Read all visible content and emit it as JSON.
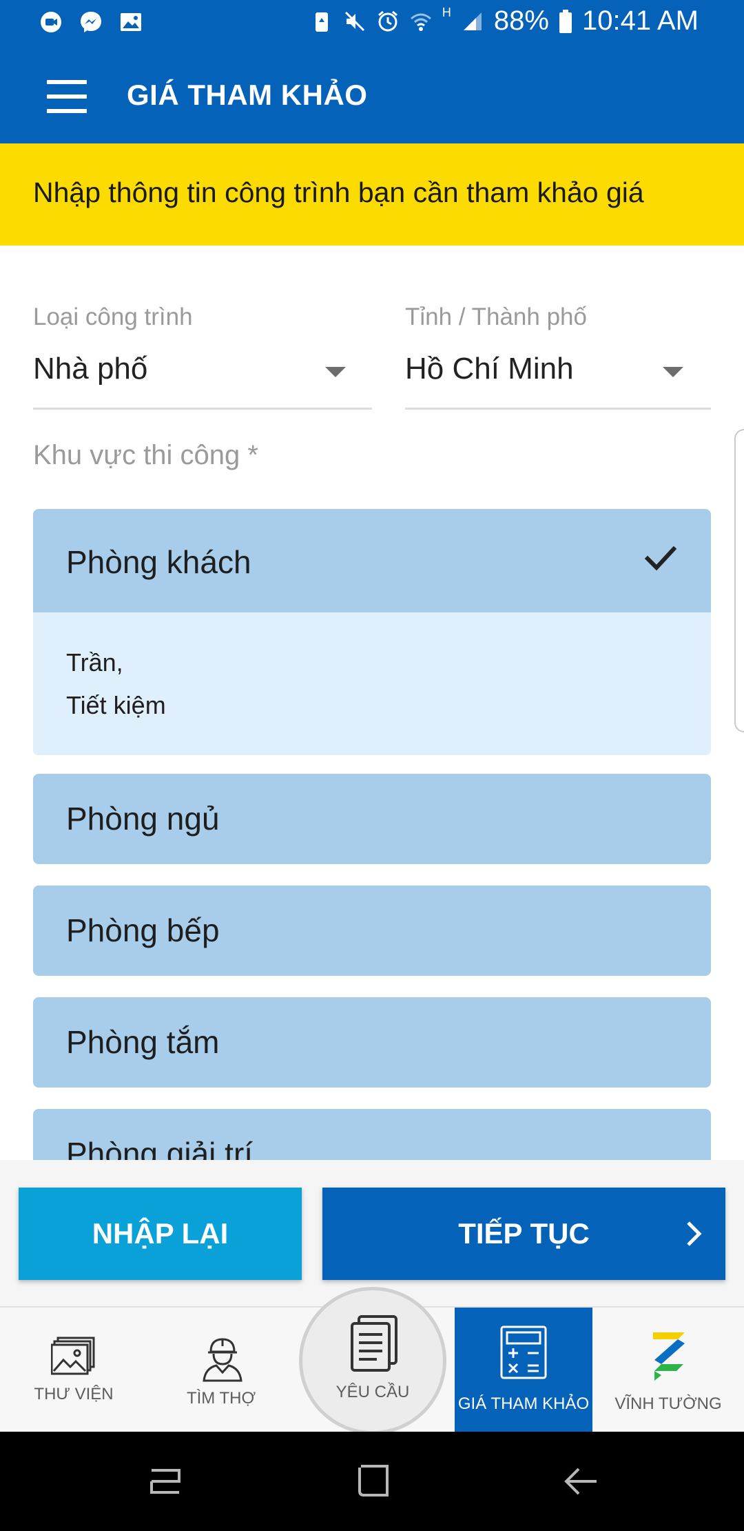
{
  "status_bar": {
    "battery": "88%",
    "time": "10:41 AM",
    "network": "H"
  },
  "app_bar": {
    "title": "GIÁ THAM KHẢO"
  },
  "banner": {
    "text": "Nhập thông tin công trình bạn cần tham khảo giá"
  },
  "form": {
    "type_label": "Loại công trình",
    "type_value": "Nhà phố",
    "city_label": "Tỉnh / Thành phố",
    "city_value": "Hồ Chí Minh",
    "area_label": "Khu vực thi công *"
  },
  "areas": [
    {
      "label": "Phòng khách",
      "selected": true,
      "details": [
        "Trần,",
        "Tiết kiệm"
      ]
    },
    {
      "label": "Phòng ngủ"
    },
    {
      "label": "Phòng bếp"
    },
    {
      "label": "Phòng tắm"
    },
    {
      "label": "Phòng giải trí"
    }
  ],
  "actions": {
    "reset_label": "NHẬP LẠI",
    "next_label": "TIẾP TỤC"
  },
  "bottom_nav": [
    {
      "label": "THƯ VIỆN",
      "icon": "gallery-icon"
    },
    {
      "label": "TÌM THỢ",
      "icon": "worker-icon"
    },
    {
      "label": "YÊU CẦU",
      "icon": "document-icon"
    },
    {
      "label": "GIÁ THAM KHẢO",
      "icon": "calculator-icon",
      "active": true
    },
    {
      "label": "VĨNH TƯỜNG",
      "icon": "vinh-tuong-logo"
    }
  ],
  "colors": {
    "primary": "#0462b8",
    "accent": "#0aa0d8",
    "banner": "#fbdb00",
    "item_bg": "#a8cdea",
    "item_detail_bg": "#dff0fc"
  }
}
